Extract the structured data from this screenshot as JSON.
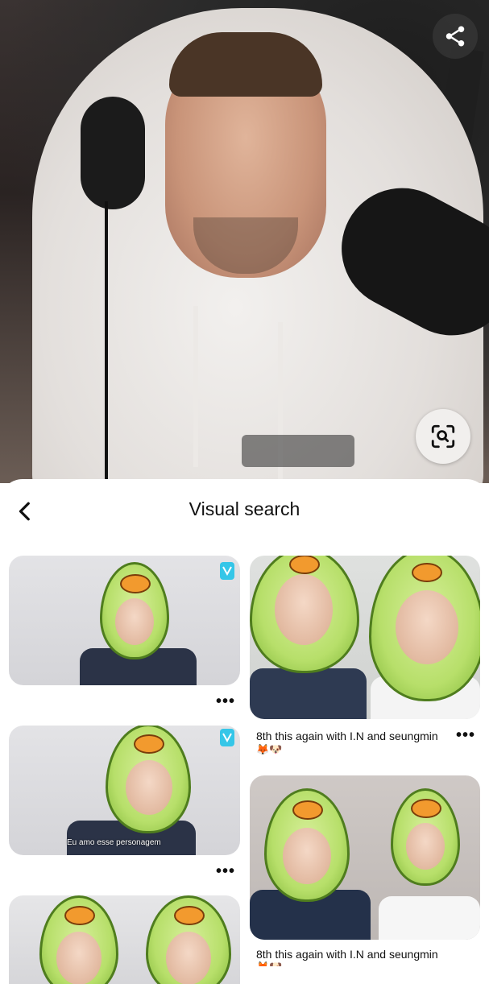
{
  "header": {
    "title": "Visual search"
  },
  "pins": [
    {
      "column": "left",
      "more_label": "•••"
    },
    {
      "column": "right",
      "caption": "8th this again with I.N and seungmin",
      "caption_emoji": "🦊🐶",
      "more_label": "•••"
    },
    {
      "column": "left",
      "subtitle_overlay": "Eu amo esse personagem",
      "more_label": "•••"
    },
    {
      "column": "right",
      "caption": "8th this again with I.N and seungmin",
      "caption_emoji": "🦊🐶"
    },
    {
      "column": "left"
    }
  ],
  "icons": [
    "share-icon",
    "visual-search-lens-icon",
    "back-arrow-icon",
    "more-options-icon",
    "vlive-logo-icon"
  ],
  "colors": {
    "accent_avocado": "#b7df6a",
    "text": "#111111",
    "sheet_bg": "#ffffff"
  }
}
